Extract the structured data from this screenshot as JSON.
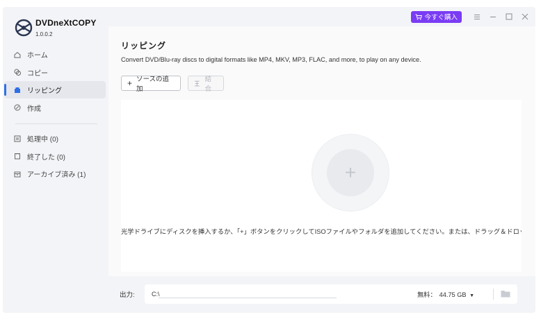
{
  "app": {
    "name": "DVDneXtCOPY",
    "version": "1.0.0.2"
  },
  "titlebar": {
    "buy_label": "今すぐ購入"
  },
  "sidebar": {
    "items": [
      {
        "label": "ホーム",
        "icon": "home-icon"
      },
      {
        "label": "コピー",
        "icon": "copy-icon"
      },
      {
        "label": "リッピング",
        "icon": "ripping-icon",
        "active": true
      },
      {
        "label": "作成",
        "icon": "create-icon"
      }
    ],
    "queue_items": [
      {
        "label": "処理中 (0)",
        "icon": "processing-icon"
      },
      {
        "label": "終了した (0)",
        "icon": "finished-icon"
      },
      {
        "label": "アーカイブ済み (1)",
        "icon": "archive-icon"
      }
    ]
  },
  "main": {
    "title": "リッピング",
    "description": "Convert DVD/Blu-ray discs to digital formats like MP4, MKV, MP3, FLAC, and more, to play on any device.",
    "add_source_label": "ソースの追加",
    "merge_label": "結合",
    "drop_hint": "光学ドライブにディスクを挿入するか、「+」ボタンをクリックしてISOファイルやフォルダを追加してください。または、ドラッグ＆ドロップで"
  },
  "output": {
    "label": "出力:",
    "path": "C:\\",
    "free_label": "無料：",
    "free_value": "44.75 GB"
  },
  "colors": {
    "accent": "#2f6fe6",
    "buy_button": "#7a3cf4",
    "sidebar_bg": "#f3f4f7"
  }
}
